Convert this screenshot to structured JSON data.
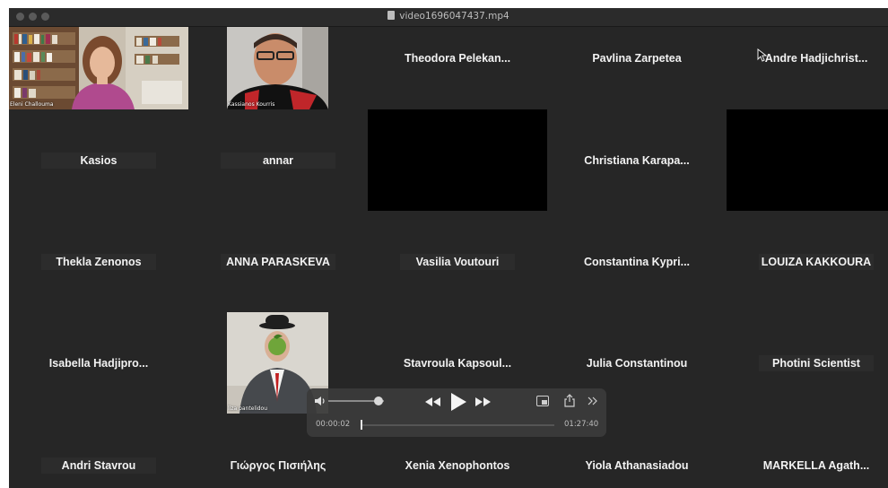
{
  "window": {
    "title": "video1696047437.mp4"
  },
  "participants": [
    {
      "label": "Eleni Challouma",
      "kind": "video"
    },
    {
      "label": "Kassianos Kourris",
      "kind": "video"
    },
    {
      "label": "Theodora  Pelekan...",
      "kind": "name"
    },
    {
      "label": "Pavlina Zarpetea",
      "kind": "name"
    },
    {
      "label": "Andre  Hadjichrist...",
      "kind": "name"
    },
    {
      "label": "Kasios",
      "kind": "name"
    },
    {
      "label": "annar",
      "kind": "name"
    },
    {
      "label": "",
      "kind": "blank"
    },
    {
      "label": "Christiana  Karapa...",
      "kind": "name"
    },
    {
      "label": "",
      "kind": "blank"
    },
    {
      "label": "Thekla Zenonos",
      "kind": "name"
    },
    {
      "label": "ANNA PARASKEVA",
      "kind": "name"
    },
    {
      "label": "Vasilia Voutouri",
      "kind": "name"
    },
    {
      "label": "Constantina  Kypri...",
      "kind": "name"
    },
    {
      "label": "LOUIZA KAKKOURA",
      "kind": "name"
    },
    {
      "label": "Isabella  Hadjipro...",
      "kind": "name"
    },
    {
      "label": "liza pantelidou",
      "kind": "image"
    },
    {
      "label": "Stavroula  Kapsoul...",
      "kind": "name"
    },
    {
      "label": "Julia Constantinou",
      "kind": "name"
    },
    {
      "label": "Photini Scientist",
      "kind": "name"
    },
    {
      "label": "Andri Stavrou",
      "kind": "name"
    },
    {
      "label": "Γιώργος Πισιήλης",
      "kind": "name"
    },
    {
      "label": "Xenia Xenophontos",
      "kind": "name"
    },
    {
      "label": "Yiola Athanasiadou",
      "kind": "name"
    },
    {
      "label": "MARKELLA  Agath...",
      "kind": "name"
    }
  ],
  "player": {
    "elapsed": "00:00:02",
    "duration": "01:27:40",
    "progress_fraction": 0.001,
    "volume_fraction": 0.9
  },
  "icons": [
    "volume-icon",
    "rewind-icon",
    "play-icon",
    "fast-forward-icon",
    "picture-in-picture-icon",
    "share-icon",
    "more-chevrons-icon",
    "file-icon",
    "mouse-cursor-icon"
  ]
}
